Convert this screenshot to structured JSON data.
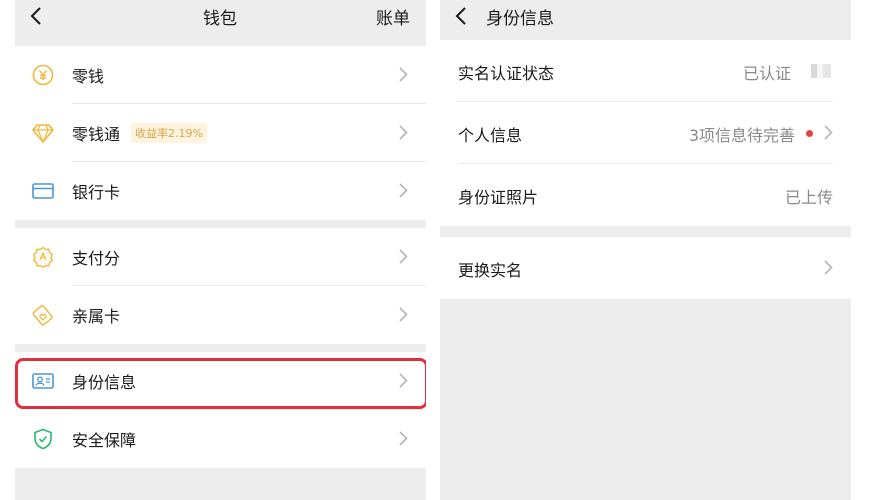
{
  "wallet": {
    "title": "钱包",
    "bill_label": "账单",
    "items": [
      {
        "label": "零钱",
        "icon": "coin-icon"
      },
      {
        "label": "零钱通",
        "icon": "diamond-icon",
        "badge": "收益率2.19%"
      },
      {
        "label": "银行卡",
        "icon": "bank-card-icon"
      },
      {
        "label": "支付分",
        "icon": "credit-score-icon"
      },
      {
        "label": "亲属卡",
        "icon": "family-card-icon"
      },
      {
        "label": "身份信息",
        "icon": "id-card-icon"
      },
      {
        "label": "安全保障",
        "icon": "shield-icon"
      }
    ]
  },
  "identity": {
    "title": "身份信息",
    "rows": [
      {
        "label": "实名认证状态",
        "value": "已认证"
      },
      {
        "label": "个人信息",
        "value": "3项信息待完善"
      },
      {
        "label": "身份证照片",
        "value": "已上传"
      },
      {
        "label": "更换实名",
        "value": ""
      }
    ]
  },
  "colors": {
    "icon_yellow": "#f0b93a",
    "icon_blue": "#4a97d6",
    "icon_green": "#2bb673",
    "highlight_red": "#e0303c",
    "badge_text": "#d9a54a",
    "red_dot": "#e64340"
  }
}
